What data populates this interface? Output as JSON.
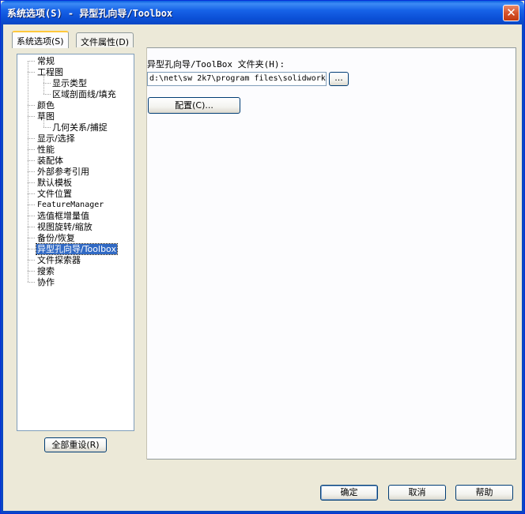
{
  "window": {
    "title": "系统选项(S) - 异型孔向导/Toolbox",
    "close_glyph": "✕"
  },
  "tabs": [
    {
      "label": "系统选项(S)",
      "active": true
    },
    {
      "label": "文件属性(D)",
      "active": false
    }
  ],
  "tree": {
    "items": [
      {
        "label": "常规",
        "level": 0
      },
      {
        "label": "工程图",
        "level": 0
      },
      {
        "label": "显示类型",
        "level": 1
      },
      {
        "label": "区域剖面线/填充",
        "level": 1
      },
      {
        "label": "颜色",
        "level": 0
      },
      {
        "label": "草图",
        "level": 0
      },
      {
        "label": "几何关系/捕捉",
        "level": 1
      },
      {
        "label": "显示/选择",
        "level": 0
      },
      {
        "label": "性能",
        "level": 0
      },
      {
        "label": "装配体",
        "level": 0
      },
      {
        "label": "外部参考引用",
        "level": 0
      },
      {
        "label": "默认模板",
        "level": 0
      },
      {
        "label": "文件位置",
        "level": 0
      },
      {
        "label": "FeatureManager",
        "level": 0
      },
      {
        "label": "选值框增量值",
        "level": 0
      },
      {
        "label": "视图旋转/缩放",
        "level": 0
      },
      {
        "label": "备份/恢复",
        "level": 0
      },
      {
        "label": "异型孔向导/Toolbox",
        "level": 0,
        "selected": true
      },
      {
        "label": "文件探索器",
        "level": 0
      },
      {
        "label": "搜索",
        "level": 0
      },
      {
        "label": "协作",
        "level": 0
      }
    ]
  },
  "reset_all_button": "全部重设(R)",
  "toolbox": {
    "folder_label": "异型孔向导/ToolBox 文件夹(H):",
    "folder_value": "d:\\net\\sw 2k7\\program files\\solidwork",
    "browse_button": "...",
    "configure_button": "配置(C)..."
  },
  "footer": {
    "ok": "确定",
    "cancel": "取消",
    "help": "帮助"
  }
}
